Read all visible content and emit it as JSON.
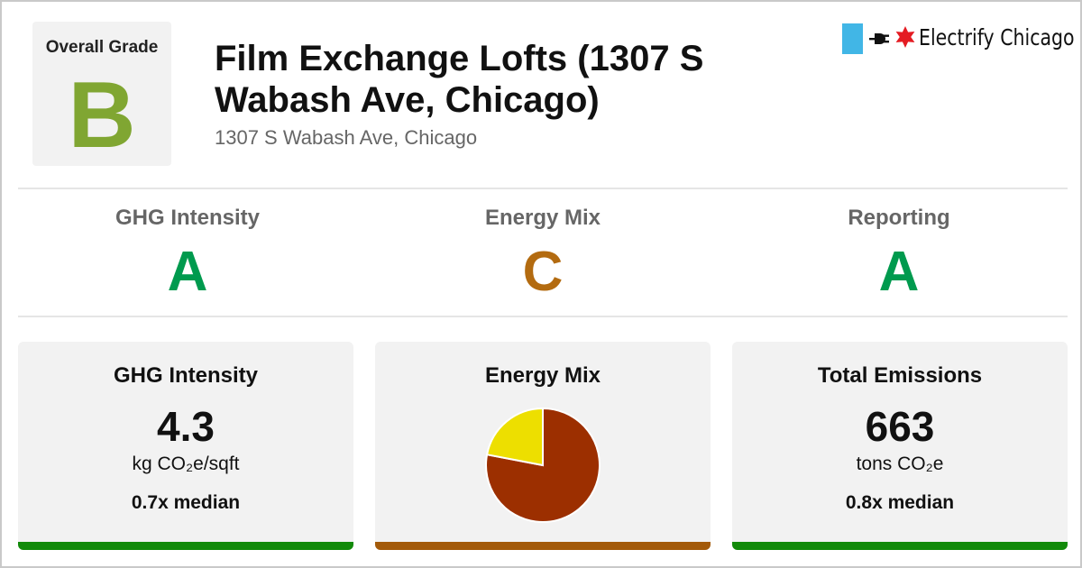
{
  "colors": {
    "grade_B": "#80a632",
    "grade_A": "#009a4e",
    "grade_C": "#b36b10",
    "bar_green": "#128a0a",
    "bar_brown": "#a35a0a",
    "pie_main": "#9c2f00",
    "pie_secondary": "#eddf00",
    "brand_flag": "#41b6e6",
    "brand_star": "#e41b22"
  },
  "overall": {
    "label": "Overall Grade",
    "grade": "B"
  },
  "building": {
    "title": "Film Exchange Lofts (1307 S Wabash Ave, Chicago)",
    "address": "1307 S Wabash Ave, Chicago"
  },
  "brand": {
    "name": "Electrify Chicago",
    "icons": [
      "chicago-flag-icon",
      "plug-icon",
      "red-star-icon"
    ]
  },
  "grades": [
    {
      "label": "GHG Intensity",
      "grade": "A"
    },
    {
      "label": "Energy Mix",
      "grade": "C"
    },
    {
      "label": "Reporting",
      "grade": "A"
    }
  ],
  "cards": {
    "ghg": {
      "title": "GHG Intensity",
      "value": "4.3",
      "unit": "kg CO₂e/sqft",
      "median": "0.7x median"
    },
    "mix": {
      "title": "Energy Mix"
    },
    "emissions": {
      "title": "Total Emissions",
      "value": "663",
      "unit": "tons CO₂e",
      "median": "0.8x median"
    }
  },
  "chart_data": {
    "type": "pie",
    "values": [
      0.78,
      0.22
    ],
    "colors": [
      "#9c2f00",
      "#eddf00"
    ]
  }
}
